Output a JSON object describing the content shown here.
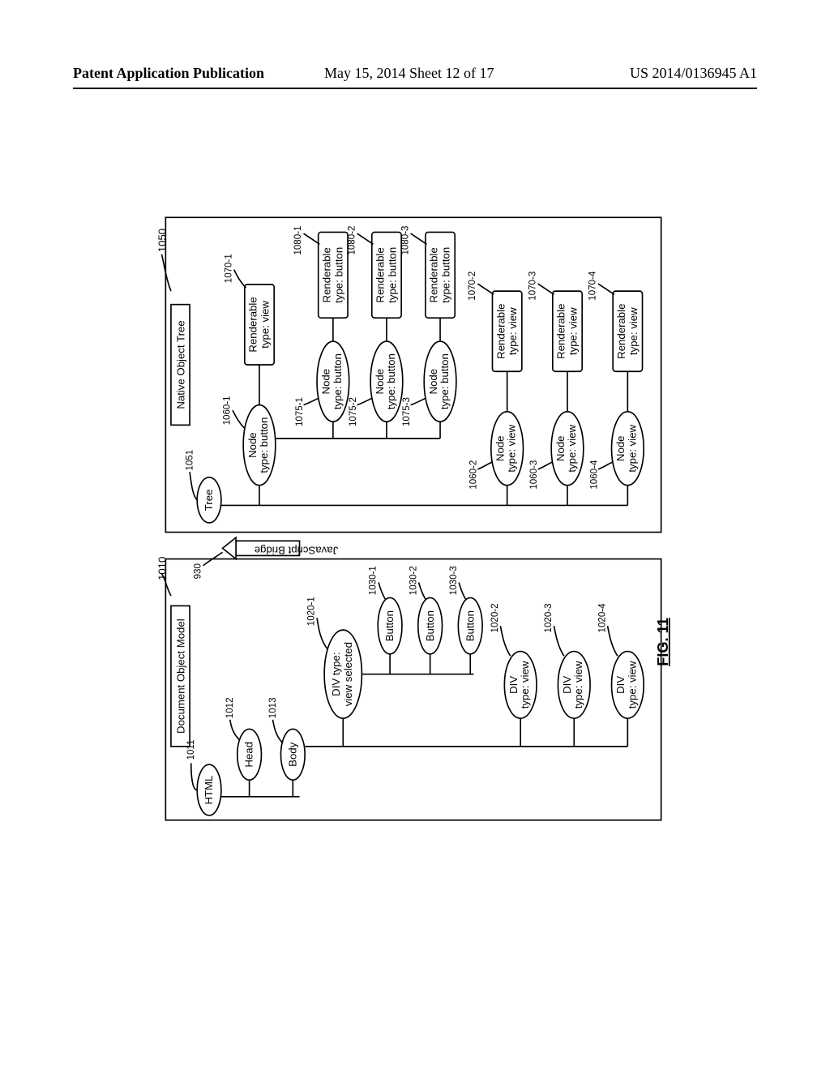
{
  "header": {
    "left": "Patent Application Publication",
    "mid": "May 15, 2014  Sheet 12 of 17",
    "right": "US 2014/0136945 A1"
  },
  "figure_caption": "FIG. 11",
  "dom": {
    "title": "Document Object Model",
    "ref_title": "1010",
    "root": "HTML",
    "root_ref": "1011",
    "head": "Head",
    "head_ref": "1012",
    "body": "Body",
    "body_ref": "1013",
    "div1": "DIV type:\nview selected",
    "div1_ref": "1020-1",
    "btn1": "Button",
    "btn1_ref": "1030-1",
    "btn2": "Button",
    "btn2_ref": "1030-2",
    "btn3": "Button",
    "btn3_ref": "1030-3",
    "div2": "DIV\ntype: view",
    "div2_ref": "1020-2",
    "div3": "DIV\ntype: view",
    "div3_ref": "1020-3",
    "div4": "DIV\ntype: view",
    "div4_ref": "1020-4"
  },
  "bridge": {
    "label": "JavaScript Bridge",
    "ref": "930"
  },
  "native": {
    "title": "Native Object Tree",
    "ref_title": "1050",
    "root": "Tree",
    "root_ref": "1051",
    "node1": "Node\ntype: button",
    "node1_ref": "1060-1",
    "rend1": "Renderable\ntype: view",
    "rend1_ref": "1070-1",
    "sub1": "Node\ntype: button",
    "sub1_ref": "1075-1",
    "rsub1": "Renderable\ntype: button",
    "rsub1_ref": "1080-1",
    "sub2": "Node\ntype: button",
    "sub2_ref": "1075-2",
    "rsub2": "Renderable\ntype: button",
    "rsub2_ref": "1080-2",
    "sub3": "Node\ntype: button",
    "sub3_ref": "1075-3",
    "rsub3": "Renderable\ntype: button",
    "rsub3_ref": "1080-3",
    "node2": "Node\ntype: view",
    "node2_ref": "1060-2",
    "rend2": "Renderable\ntype: view",
    "rend2_ref": "1070-2",
    "node3": "Node\ntype: view",
    "node3_ref": "1060-3",
    "rend3": "Renderable\ntype: view",
    "rend3_ref": "1070-3",
    "node4": "Node\ntype: view",
    "node4_ref": "1060-4",
    "rend4": "Renderable\ntype: view",
    "rend4_ref": "1070-4"
  }
}
